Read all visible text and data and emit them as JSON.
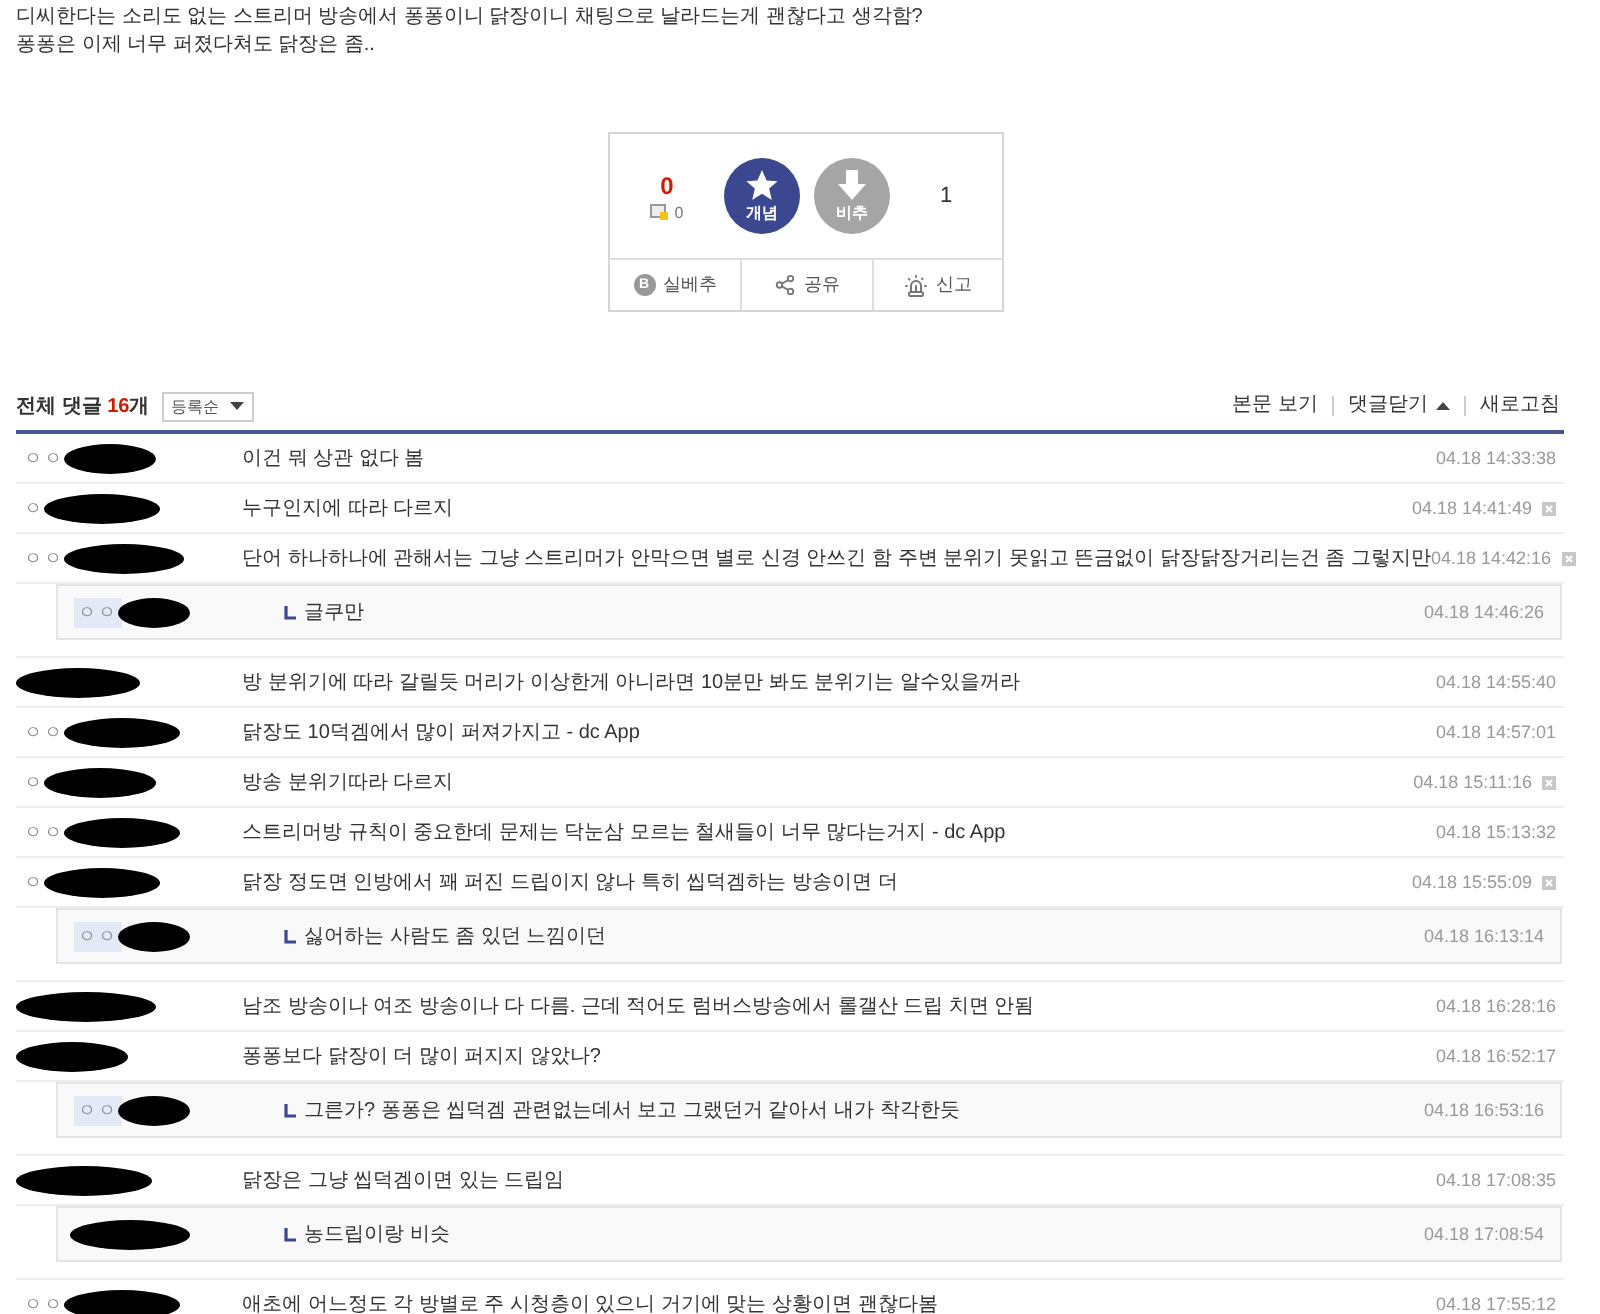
{
  "post": {
    "body_lines": [
      "디씨한다는 소리도 없는 스트리머 방송에서 퐁퐁이니 닭장이니 채팅으로 날라드는게 괜찮다고 생각함?",
      "퐁퐁은 이제 너무 퍼졌다쳐도 닭장은 좀.."
    ]
  },
  "vote": {
    "upvotes": "0",
    "fixed_upvotes": "0",
    "upvote_label": "개념",
    "downvote_label": "비추",
    "downvotes": "1",
    "actions": [
      {
        "kind": "best",
        "badge": "B",
        "label": "실베추"
      },
      {
        "kind": "share",
        "label": "공유"
      },
      {
        "kind": "report",
        "label": "신고"
      }
    ]
  },
  "comments_header": {
    "title": "전체 댓글",
    "count": "16",
    "count_unit": "개",
    "sort": "등록순",
    "links": [
      {
        "kind": "plain",
        "label": "본문 보기"
      },
      {
        "kind": "collapse",
        "label": "댓글닫기"
      },
      {
        "kind": "plain",
        "label": "새로고침"
      }
    ]
  },
  "comments": [
    {
      "nickname": "ㅇㅇ",
      "text": "이건 뭐 상관 없다 봄",
      "time": "04.18 14:33:38",
      "delete_button": false
    },
    {
      "nickname": "ㅇ",
      "text": "누구인지에 따라 다르지",
      "time": "04.18 14:41:49",
      "delete_button": true
    },
    {
      "nickname": "ㅇㅇ",
      "text": "단어 하나하나에 관해서는 그냥 스트리머가 안막으면 별로 신경 안쓰긴 함 주변 분위기 못읽고 뜬금없이 닭장닭장거리는건 좀 그렇지만",
      "time": "04.18 14:42:16",
      "delete_button": true,
      "replies": [
        {
          "nickname": "ㅇㅇ",
          "text": "글쿠만",
          "time": "04.18 14:46:26"
        }
      ]
    },
    {
      "text": "방 분위기에 따라 갈릴듯 머리가 이상한게 아니라면 10분만 봐도 분위기는 알수있을꺼라",
      "time": "04.18 14:55:40",
      "delete_button": false
    },
    {
      "nickname": "ㅇㅇ",
      "text": "닭장도 10덕겜에서 많이 퍼져가지고 - dc App",
      "time": "04.18 14:57:01",
      "delete_button": false
    },
    {
      "nickname": "ㅇ",
      "text": "방송 분위기따라 다르지",
      "time": "04.18 15:11:16",
      "delete_button": true
    },
    {
      "nickname": "ㅇㅇ",
      "text": "스트리머방 규칙이 중요한데 문제는 닥눈삼 모르는 철새들이 너무 많다는거지 - dc App",
      "time": "04.18 15:13:32",
      "delete_button": false
    },
    {
      "nickname": "ㅇ",
      "text": "닭장 정도면 인방에서 꽤 퍼진 드립이지 않나 특히 씹덕겜하는 방송이면 더",
      "time": "04.18 15:55:09",
      "delete_button": true,
      "replies": [
        {
          "nickname": "ㅇㅇ",
          "text": "싫어하는 사람도 좀 있던 느낌이던",
          "time": "04.18 16:13:14"
        }
      ]
    },
    {
      "text": "남조 방송이나 여조 방송이나 다 다름. 근데 적어도 럼버스방송에서 롤갤산 드립 치면 안됨",
      "time": "04.18 16:28:16",
      "delete_button": false
    },
    {
      "text": "퐁퐁보다 닭장이 더 많이 퍼지지 않았나?",
      "time": "04.18 16:52:17",
      "delete_button": false,
      "replies": [
        {
          "nickname": "ㅇㅇ",
          "text": "그른가? 퐁퐁은 씹덕겜 관련없는데서 보고 그랬던거 같아서 내가 착각한듯",
          "time": "04.18 16:53:16"
        }
      ]
    },
    {
      "text": "닭장은 그냥 씹덕겜이면 있는 드립임",
      "time": "04.18 17:08:35",
      "delete_button": false,
      "replies": [
        {
          "text": "농드립이랑 비슷",
          "time": "04.18 17:08:54"
        }
      ]
    },
    {
      "nickname": "ㅇㅇ",
      "text": "애초에 어느정도 각 방별로 주 시청층이 있으니 거기에 맞는 상황이면 괜찮다봄",
      "time": "04.18 17:55:12",
      "delete_button": false
    }
  ]
}
